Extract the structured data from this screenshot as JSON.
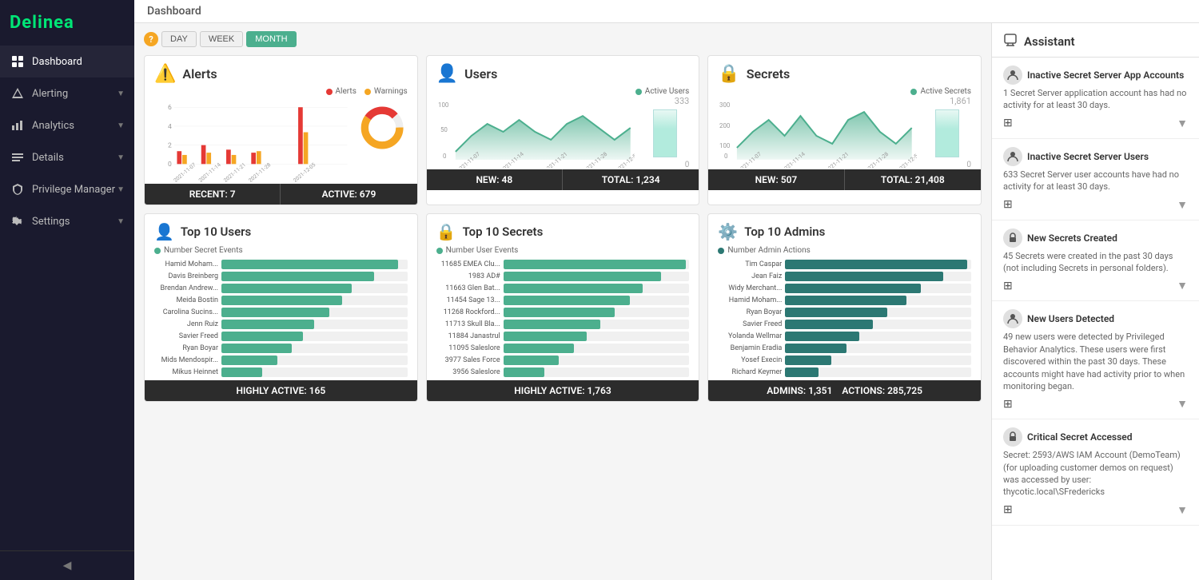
{
  "app": {
    "logo": "Delinea",
    "topbar_title": "Dashboard"
  },
  "sidebar": {
    "items": [
      {
        "id": "dashboard",
        "label": "Dashboard",
        "icon": "grid",
        "active": true,
        "has_children": false
      },
      {
        "id": "alerting",
        "label": "Alerting",
        "icon": "bell",
        "active": false,
        "has_children": true
      },
      {
        "id": "analytics",
        "label": "Analytics",
        "icon": "chart",
        "active": false,
        "has_children": true
      },
      {
        "id": "details",
        "label": "Details",
        "icon": "list",
        "active": false,
        "has_children": true
      },
      {
        "id": "privilege-manager",
        "label": "Privilege Manager",
        "icon": "shield",
        "active": false,
        "has_children": true
      },
      {
        "id": "settings",
        "label": "Settings",
        "icon": "gear",
        "active": false,
        "has_children": true
      }
    ]
  },
  "filters": {
    "buttons": [
      {
        "id": "day",
        "label": "DAY",
        "active": false
      },
      {
        "id": "week",
        "label": "WEEK",
        "active": false
      },
      {
        "id": "month",
        "label": "MONTH",
        "active": true
      }
    ]
  },
  "alerts_card": {
    "title": "Alerts",
    "legend_alerts": "Alerts",
    "legend_warnings": "Warnings",
    "footer_recent_label": "RECENT: 7",
    "footer_active_label": "ACTIVE: 679"
  },
  "users_card": {
    "title": "Users",
    "count": "333",
    "zero": "0",
    "legend_label": "Active Users",
    "footer_new_label": "NEW: 48",
    "footer_total_label": "TOTAL: 1,234"
  },
  "secrets_card": {
    "title": "Secrets",
    "count": "1,861",
    "zero": "0",
    "legend_label": "Active Secrets",
    "footer_new_label": "NEW: 507",
    "footer_total_label": "TOTAL: 21,408"
  },
  "top10_users": {
    "title": "Top 10 Users",
    "legend_label": "Number Secret Events",
    "footer_label": "HIGHLY ACTIVE: 165",
    "bars": [
      {
        "label": "Hamid Moham...",
        "value": 95
      },
      {
        "label": "Davis Breinberg",
        "value": 82
      },
      {
        "label": "Brendan Andrew...",
        "value": 70
      },
      {
        "label": "Meida Bostin",
        "value": 65
      },
      {
        "label": "Carolina Sucins...",
        "value": 58
      },
      {
        "label": "Jenn Ruiz",
        "value": 50
      },
      {
        "label": "Savier Freed",
        "value": 44
      },
      {
        "label": "Ryan Boyar",
        "value": 38
      },
      {
        "label": "Mids Mendospir...",
        "value": 30
      },
      {
        "label": "Mikus Heinnet",
        "value": 22
      }
    ],
    "axis": [
      0,
      200,
      400,
      600,
      800
    ]
  },
  "top10_secrets": {
    "title": "Top 10 Secrets",
    "legend_label": "Number User Events",
    "footer_label": "HIGHLY ACTIVE: 1,763",
    "bars": [
      {
        "label": "11685 EMEA Clu...",
        "value": 98
      },
      {
        "label": "1983 AD#",
        "value": 85
      },
      {
        "label": "11663 Glen Bat...",
        "value": 75
      },
      {
        "label": "11454 Sage 13...",
        "value": 68
      },
      {
        "label": "11268 Rockford...",
        "value": 60
      },
      {
        "label": "11713 Skull Bla...",
        "value": 52
      },
      {
        "label": "11884 Janastrul",
        "value": 45
      },
      {
        "label": "11095 Saleslore",
        "value": 38
      },
      {
        "label": "3977 Sales Force",
        "value": 30
      },
      {
        "label": "3956 Saleslore",
        "value": 22
      }
    ],
    "axis": [
      0,
      200,
      400,
      600
    ]
  },
  "top10_admins": {
    "title": "Top 10 Admins",
    "legend_label": "Number Admin Actions",
    "footer_label": "ADMINS: 1,351",
    "footer_label2": "ACTIONS: 285,725",
    "bars": [
      {
        "label": "Tim Caspar",
        "value": 98
      },
      {
        "label": "Jean Faiz",
        "value": 85
      },
      {
        "label": "Widy Merchant...",
        "value": 73
      },
      {
        "label": "Hamid Moham...",
        "value": 65
      },
      {
        "label": "Ryan Boyar",
        "value": 55
      },
      {
        "label": "Savier Freed",
        "value": 47
      },
      {
        "label": "Yolanda Wellmar",
        "value": 40
      },
      {
        "label": "Benjamin Eradia",
        "value": 33
      },
      {
        "label": "Yosef Execin",
        "value": 25
      },
      {
        "label": "Richard Keymer",
        "value": 18
      }
    ],
    "axis": [
      0,
      50,
      100,
      150
    ]
  },
  "assistant": {
    "title": "Assistant",
    "notifications": [
      {
        "title": "Inactive Secret Server App Accounts",
        "desc": "1 Secret Server application account has had no activity for at least 30 days.",
        "icon": "user"
      },
      {
        "title": "Inactive Secret Server Users",
        "desc": "633 Secret Server user accounts have had no activity for at least 30 days.",
        "icon": "user"
      },
      {
        "title": "New Secrets Created",
        "desc": "45 Secrets were created in the past 30 days (not including Secrets in personal folders).",
        "icon": "lock"
      },
      {
        "title": "New Users Detected",
        "desc": "49 new users were detected by Privileged Behavior Analytics. These users were first discovered within the past 30 days. These accounts might have had activity prior to when monitoring began.",
        "icon": "user"
      },
      {
        "title": "Critical Secret Accessed",
        "desc": "Secret: 2593/AWS IAM Account (DemoTeam) (for uploading customer demos on request) was accessed by user: thycotic.local\\SFredericks",
        "icon": "lock"
      }
    ]
  }
}
